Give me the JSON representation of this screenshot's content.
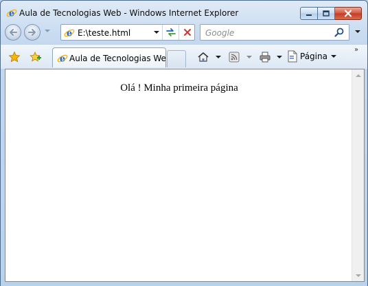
{
  "window": {
    "title": "Aula de Tecnologias Web - Windows Internet Explorer"
  },
  "navigation": {
    "address": "E:\\teste.html",
    "search_placeholder": "Google"
  },
  "command_bar": {
    "tab_label": "Aula de Tecnologias Web",
    "page_menu_label": "Página",
    "overflow_label": "»"
  },
  "content": {
    "text": "Olá ! Minha primeira página"
  },
  "icons": {
    "browser": "ie-logo-icon",
    "back": "back-arrow-icon",
    "forward": "forward-arrow-icon",
    "refresh": "refresh-icon",
    "stop": "stop-icon",
    "search": "search-icon",
    "favorites": "favorites-star-icon",
    "add_favorites": "add-favorites-icon",
    "home": "home-icon",
    "feeds": "rss-feed-icon",
    "print": "printer-icon",
    "page": "page-icon"
  },
  "colors": {
    "frame": "#b9d1ea",
    "ie_blue": "#1e6fd0",
    "ie_ring": "#f2b51b",
    "close_button": "#c23b22",
    "star": "#f5b50a"
  }
}
